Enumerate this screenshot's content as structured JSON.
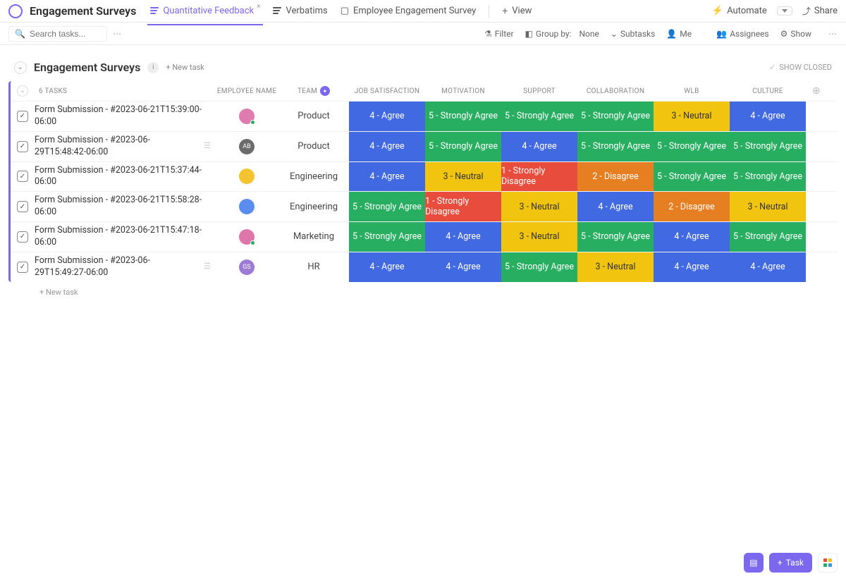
{
  "header": {
    "title": "Engagement Surveys",
    "tabs": [
      {
        "label": "Quantitative Feedback",
        "active": true,
        "closable": true
      },
      {
        "label": "Verbatims",
        "active": false,
        "closable": false
      },
      {
        "label": "Employee Engagement Survey",
        "active": false,
        "closable": false
      }
    ],
    "view_label": "View",
    "automate_label": "Automate",
    "share_label": "Share"
  },
  "toolbar": {
    "search_placeholder": "Search tasks...",
    "filter": "Filter",
    "group_by_label": "Group by:",
    "group_by_value": "None",
    "subtasks": "Subtasks",
    "me": "Me",
    "assignees": "Assignees",
    "show": "Show"
  },
  "group": {
    "title": "Engagement Surveys",
    "new_task": "+ New task",
    "show_closed": "SHOW CLOSED",
    "task_count_label": "6 TASKS",
    "footer_new_task": "+ New task"
  },
  "columns": {
    "name": "",
    "employee_name": "EMPLOYEE NAME",
    "team": "TEAM",
    "job_satisfaction": "JOB SATISFACTION",
    "motivation": "MOTIVATION",
    "support": "SUPPORT",
    "collaboration": "COLLABORATION",
    "wlb": "WLB",
    "culture": "CULTURE"
  },
  "score_labels": {
    "1": "1 - Strongly Disagree",
    "2": "2 - Disagree",
    "3": "3 - Neutral",
    "4": "4 - Agree",
    "5": "5 - Strongly Agree"
  },
  "score_colors": {
    "1": "c-red",
    "2": "c-orange",
    "3": "c-yellow",
    "4": "c-blue",
    "5": "c-green"
  },
  "rows": [
    {
      "name": "Form Submission - #2023-06-21T15:39:00-06:00",
      "has_note": false,
      "avatar": {
        "bg": "#e07bb0",
        "initials": "",
        "online": true
      },
      "team": "Product",
      "scores": [
        4,
        5,
        5,
        5,
        3,
        4
      ]
    },
    {
      "name": "Form Submission - #2023-06-29T15:48:42-06:00",
      "has_note": true,
      "avatar": {
        "bg": "#6b6b6b",
        "initials": "AB",
        "online": false
      },
      "team": "Product",
      "scores": [
        4,
        5,
        4,
        5,
        5,
        5
      ]
    },
    {
      "name": "Form Submission - #2023-06-21T15:37:44-06:00",
      "has_note": false,
      "avatar": {
        "bg": "#f4c430",
        "initials": "",
        "online": false
      },
      "team": "Engineering",
      "scores": [
        4,
        3,
        1,
        2,
        5,
        5
      ]
    },
    {
      "name": "Form Submission - #2023-06-21T15:58:28-06:00",
      "has_note": false,
      "avatar": {
        "bg": "#5b8def",
        "initials": "",
        "online": false
      },
      "team": "Engineering",
      "scores": [
        5,
        1,
        3,
        4,
        2,
        3
      ]
    },
    {
      "name": "Form Submission - #2023-06-21T15:47:18-06:00",
      "has_note": false,
      "avatar": {
        "bg": "#d7a",
        "initials": "",
        "online": true
      },
      "team": "Marketing",
      "scores": [
        5,
        4,
        3,
        5,
        4,
        5
      ]
    },
    {
      "name": "Form Submission - #2023-06-29T15:49:27-06:00",
      "has_note": true,
      "avatar": {
        "bg": "#9b7bd4",
        "initials": "GS",
        "online": false
      },
      "team": "HR",
      "scores": [
        4,
        4,
        5,
        3,
        4,
        4
      ]
    }
  ],
  "float": {
    "task_label": "Task"
  }
}
